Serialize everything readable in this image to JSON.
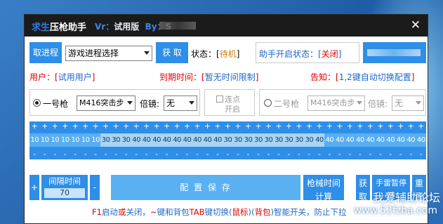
{
  "window": {
    "title_pre": "求生",
    "title_post": "压枪助手",
    "version_label": "Vr：",
    "version_value": "试用版",
    "by_label": "By：",
    "by_value": "S"
  },
  "top_row": {
    "get_process_button": "取进程",
    "process_select_value": "游戏进程选择",
    "get_button": "获 取",
    "status_label": "状态：[",
    "status_value": "待机",
    "status_close": "]",
    "helper_status_label": "助手开启状态：[",
    "helper_status_value": "关闭",
    "helper_status_close": "]"
  },
  "info_row": {
    "user_label": "用户：[",
    "user_value": "试用用户",
    "user_close": "]",
    "expire_label": "到期时间：[",
    "expire_value": "暂无时间限制",
    "expire_close": "]",
    "notice_label": "告知：[",
    "notice_value": "1,2键自动切换配置",
    "notice_close": "]"
  },
  "gun1": {
    "label": "一号枪",
    "weapon": "M416突击步",
    "multiplier_label": "倍镜:",
    "multiplier": "无"
  },
  "burst": {
    "line1": "连点",
    "line2": "开启"
  },
  "gun2": {
    "label": "二号枪",
    "weapon": "M416突击步",
    "multiplier_label": "倍镜:",
    "multiplier": "无"
  },
  "grid": {
    "plus": "+",
    "minus": "-",
    "values": [
      "10",
      "10",
      "10",
      "10",
      "10",
      "10",
      "10",
      "30",
      "30",
      "30",
      "40",
      "40",
      "40",
      "40",
      "40",
      "40",
      "40",
      "40",
      "40",
      "30",
      "30",
      "30",
      "30",
      "30",
      "30",
      "30",
      "30",
      "30",
      "40",
      "40",
      "40",
      "40",
      "40",
      "40",
      "40",
      "40",
      "40",
      "40",
      "40"
    ],
    "styles": [
      "d",
      "d",
      "d",
      "d",
      "d",
      "d",
      "d",
      "l",
      "l",
      "l",
      "l",
      "l",
      "l",
      "l",
      "l",
      "l",
      "l",
      "l",
      "l",
      "l",
      "l",
      "l",
      "l",
      "l",
      "l",
      "l",
      "l",
      "l",
      "l",
      "d",
      "d",
      "d",
      "d",
      "d",
      "d",
      "d",
      "d",
      "d",
      "d"
    ]
  },
  "bottom_row": {
    "plus": "+",
    "interval_label": "间隔时间",
    "interval_value": "70",
    "minus": "-",
    "save_button": "配 置 保 存",
    "mech_time_line1": "枪械时间",
    "mech_time_line2": "计算",
    "get_line1": "获",
    "get_line2": "取",
    "grenade_line1": "手雷暂停",
    "grenade_line2": "键",
    "reset_line1": "重",
    "reset_line2": "置"
  },
  "tip": {
    "part1": "F1",
    "part2": "启动",
    "part3": "或",
    "part4": "关闭，",
    "part5": "~",
    "part6": "键和背包",
    "part7": "TAB",
    "part8": "键切换(",
    "part9": "鼠标",
    "part10": ")(",
    "part11": "背包",
    "part12": ")智能开关，防止下拉"
  },
  "watermark": {
    "line1": "我爱辅助论坛",
    "line2": "www.52fzba.com"
  },
  "colors": {
    "accent_blue": "#2e8ee8",
    "light_cell": "#a8d5f5",
    "red_text": "#e00000",
    "titlebar": "#1b1b1b"
  }
}
